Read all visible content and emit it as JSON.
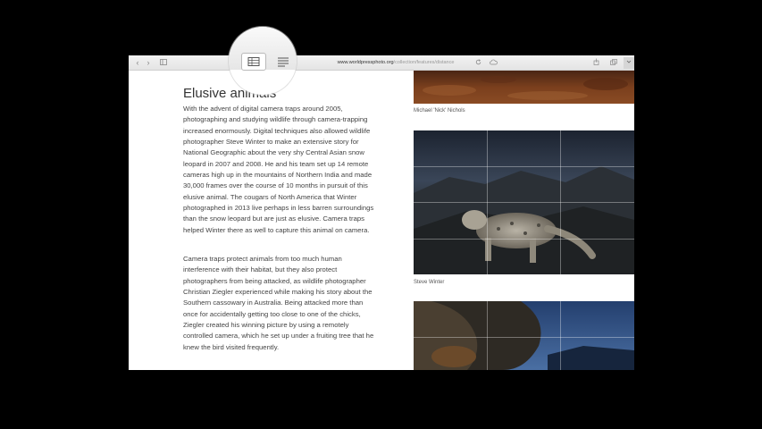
{
  "browser": {
    "url_domain": "www.worldpressphoto.org",
    "url_path": "/collection/features/distance"
  },
  "article": {
    "title": "Elusive animals",
    "paragraphs": [
      "With the advent of digital camera traps around 2005, photographing and studying wildlife through camera-trapping increased enormously. Digital techniques also allowed wildlife photographer Steve Winter to make an extensive story for National Geographic about the very shy Central Asian snow leopard in 2007 and 2008. He and his team set up 14 remote cameras high up in the mountains of Northern India and made 30,000 frames over the course of 10 months in pursuit of this elusive animal. The cougars of North America that Winter photographed in 2013 live perhaps in less barren surroundings than the snow leopard but are just as elusive. Camera traps helped Winter there as well to capture this animal on camera.",
      "Camera traps protect animals from too much human interference with their habitat, but they also protect photographers from being attacked, as wildlife photographer Christian Ziegler experienced while making his story about the Southern cassowary in Australia. Being attacked more than once for accidentally getting too close to one of the chicks, Ziegler created his winning picture by using a remotely controlled camera, which he set up under a fruiting tree that he knew the bird visited frequently."
    ]
  },
  "photos": [
    {
      "caption": "Michael 'Nick' Nichols"
    },
    {
      "caption": "Steve Winter"
    },
    {
      "caption": ""
    }
  ],
  "icons": {
    "back": "chevron-left-icon",
    "forward": "chevron-right-icon",
    "sidebar": "sidebar-icon",
    "reload": "reload-icon",
    "cloud": "icloud-icon",
    "share": "share-icon",
    "tabs": "tabs-icon",
    "reader": "reader-view-icon",
    "list": "text-lines-icon"
  }
}
